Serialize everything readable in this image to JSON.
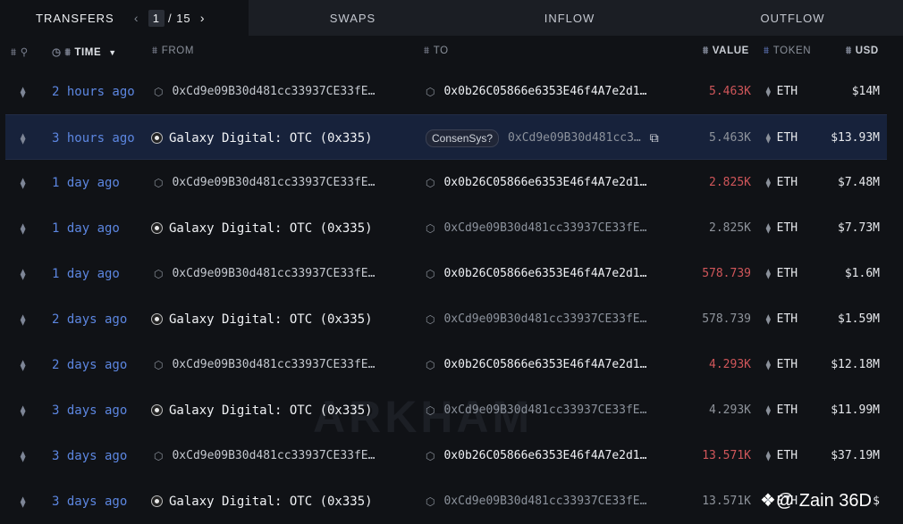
{
  "tabs": {
    "transfers": "TRANSFERS",
    "swaps": "SWAPS",
    "inflow": "INFLOW",
    "outflow": "OUTFLOW",
    "pager": {
      "prev": "‹",
      "current": "1",
      "separator_total": "/ 15",
      "next": "›"
    }
  },
  "columns": {
    "time": "TIME",
    "from": "FROM",
    "to": "TO",
    "value": "VALUE",
    "token": "TOKEN",
    "usd": "USD"
  },
  "rows": [
    {
      "time": "2 hours ago",
      "from": "0xCd9e09B30d481cc33937CE33fE…",
      "to": "0x0b26C05866e6353E46f4A7e2d1…",
      "value": "5.463K",
      "token": "ETH",
      "usd": "$14M"
    },
    {
      "time": "3 hours ago",
      "from": "Galaxy Digital: OTC (0x335)",
      "to_badge": "ConsenSys?",
      "to": "0xCd9e09B30d481cc3…",
      "value": "5.463K",
      "token": "ETH",
      "usd": "$13.93M"
    },
    {
      "time": "1 day ago",
      "from": "0xCd9e09B30d481cc33937CE33fE…",
      "to": "0x0b26C05866e6353E46f4A7e2d1…",
      "value": "2.825K",
      "token": "ETH",
      "usd": "$7.48M"
    },
    {
      "time": "1 day ago",
      "from": "Galaxy Digital: OTC (0x335)",
      "to": "0xCd9e09B30d481cc33937CE33fE…",
      "value": "2.825K",
      "token": "ETH",
      "usd": "$7.73M"
    },
    {
      "time": "1 day ago",
      "from": "0xCd9e09B30d481cc33937CE33fE…",
      "to": "0x0b26C05866e6353E46f4A7e2d1…",
      "value": "578.739",
      "token": "ETH",
      "usd": "$1.6M"
    },
    {
      "time": "2 days ago",
      "from": "Galaxy Digital: OTC (0x335)",
      "to": "0xCd9e09B30d481cc33937CE33fE…",
      "value": "578.739",
      "token": "ETH",
      "usd": "$1.59M"
    },
    {
      "time": "2 days ago",
      "from": "0xCd9e09B30d481cc33937CE33fE…",
      "to": "0x0b26C05866e6353E46f4A7e2d1…",
      "value": "4.293K",
      "token": "ETH",
      "usd": "$12.18M"
    },
    {
      "time": "3 days ago",
      "from": "Galaxy Digital: OTC (0x335)",
      "to": "0xCd9e09B30d481cc33937CE33fE…",
      "value": "4.293K",
      "token": "ETH",
      "usd": "$11.99M"
    },
    {
      "time": "3 days ago",
      "from": "0xCd9e09B30d481cc33937CE33fE…",
      "to": "0x0b26C05866e6353E46f4A7e2d1…",
      "value": "13.571K",
      "token": "ETH",
      "usd": "$37.19M"
    },
    {
      "time": "3 days ago",
      "from": "Galaxy Digital: OTC (0x335)",
      "to": "0xCd9e09B30d481cc33937CE33fE…",
      "value": "13.571K",
      "token": "ETH",
      "usd": "$"
    }
  ],
  "watermark": "ARKHAM",
  "credit": "❖@ Zain 36D",
  "colors": {
    "accent_blue": "#5c86e0",
    "value_red": "#d0565a",
    "selected_row": "#17223b"
  }
}
